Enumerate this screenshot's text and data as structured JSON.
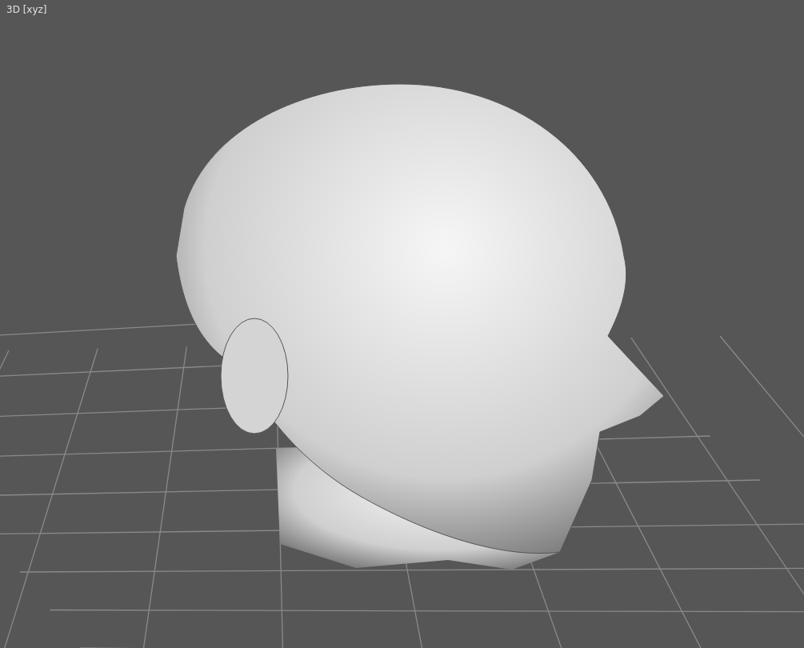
{
  "viewport": {
    "label": "3D [xyz]"
  }
}
